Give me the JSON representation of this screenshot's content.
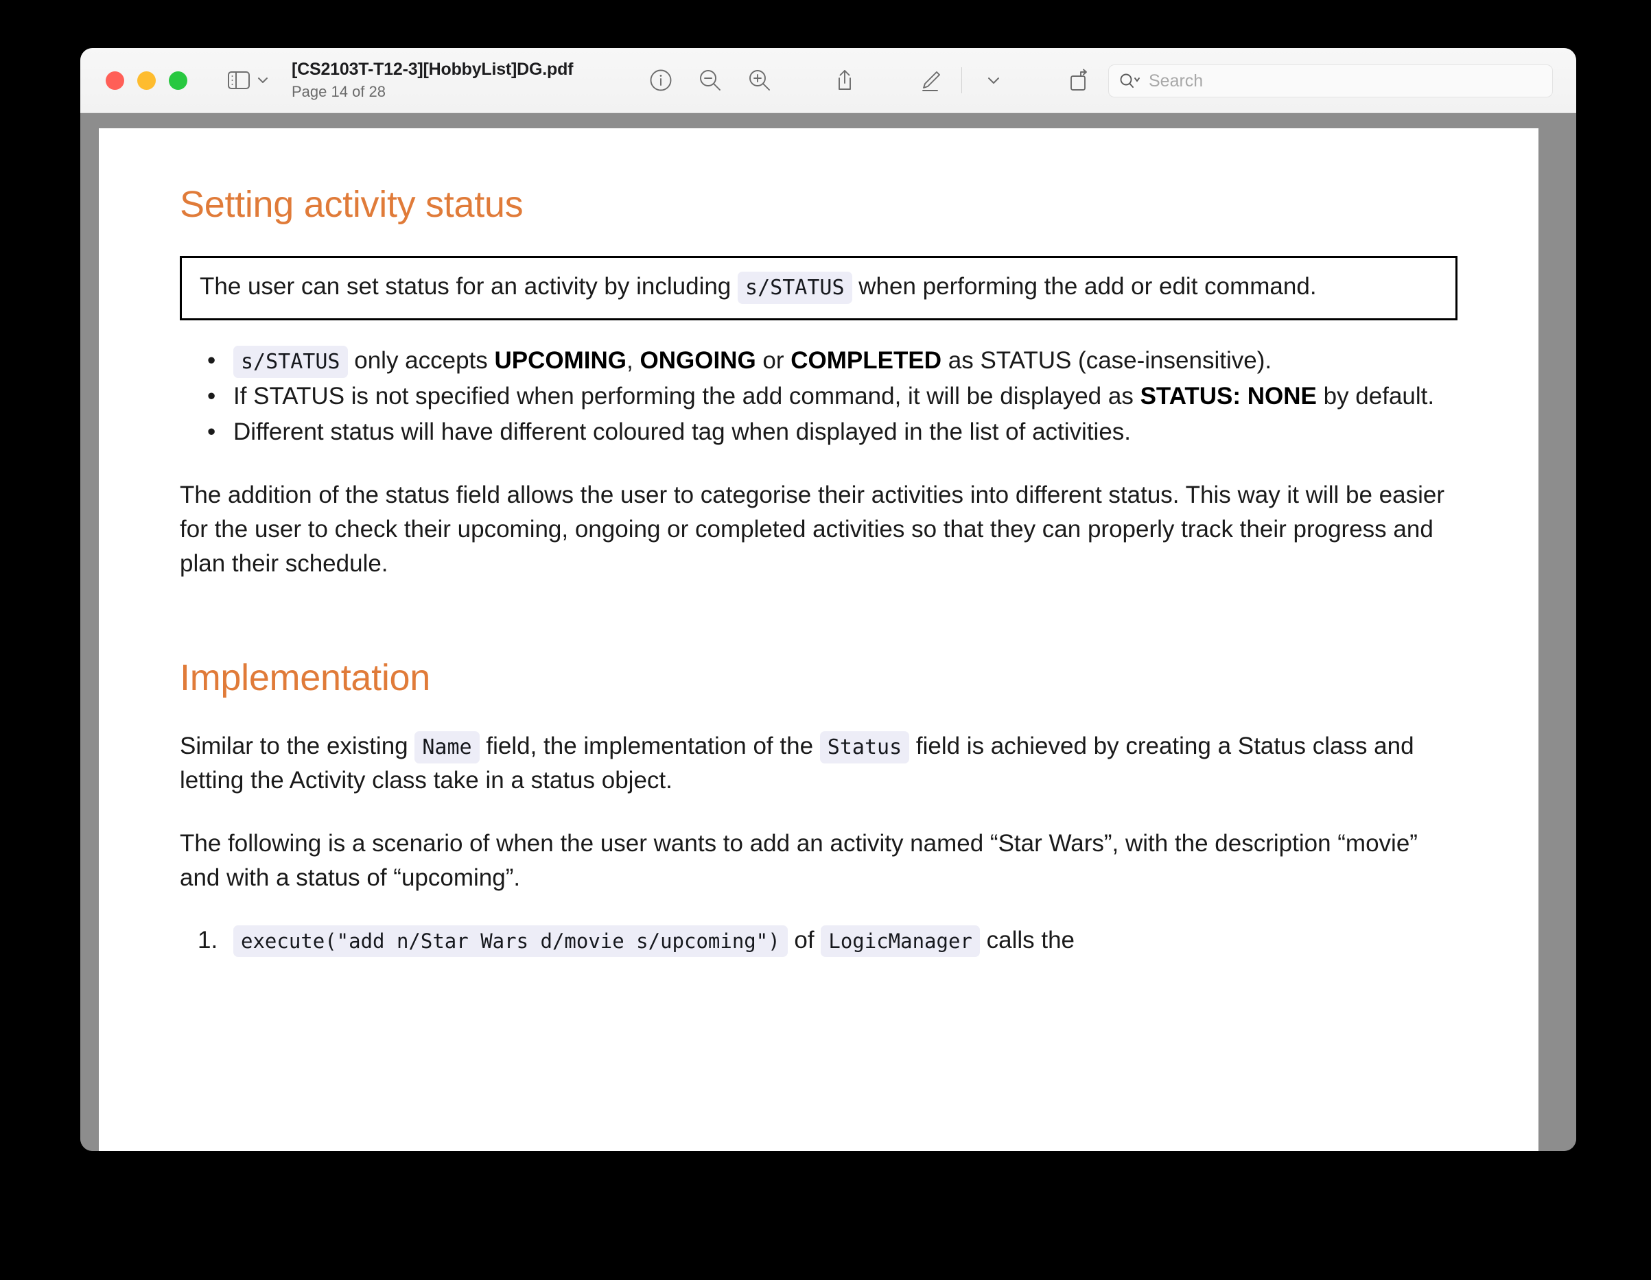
{
  "window": {
    "traffic_lights": [
      "close",
      "minimize",
      "maximize"
    ],
    "doc_title": "[CS2103T-T12-3][HobbyList]DG.pdf",
    "page_indicator": "Page 14 of 28",
    "toolbar": [
      {
        "name": "info-icon",
        "label": "Show Info"
      },
      {
        "name": "zoom-out-icon",
        "label": "Zoom Out"
      },
      {
        "name": "zoom-in-icon",
        "label": "Zoom In"
      },
      {
        "name": "share-icon",
        "label": "Share"
      },
      {
        "name": "markup-pen-icon",
        "label": "Markup"
      },
      {
        "name": "chevron-down-icon",
        "label": "Markup Options"
      },
      {
        "name": "rotate-icon",
        "label": "Rotate"
      },
      {
        "name": "annotate-icon",
        "label": "Annotate"
      }
    ],
    "search": {
      "placeholder": "Search",
      "value": ""
    }
  },
  "document": {
    "heading_1": "Setting activity status",
    "callout": {
      "part1": "The user can set status for an activity by including",
      "code": "s/STATUS",
      "part2": "when performing the add or edit command."
    },
    "bullets": [
      {
        "code": "s/STATUS",
        "text_a": "only accepts",
        "bold_1": "UPCOMING",
        "sep_1": ",",
        "bold_2": "ONGOING",
        "sep_2": "or",
        "bold_3": "COMPLETED",
        "text_b": "as STATUS (case-insensitive)."
      },
      {
        "text_a": "If STATUS is not specified when performing the add command, it will be displayed as",
        "bold_1": "STATUS: NONE",
        "text_b": "by default."
      },
      {
        "text_a": "Different status will have different coloured tag when displayed in the list of activities."
      }
    ],
    "paragraph_1": "The addition of the status field allows the user to categorise their activities into different status. This way it will be easier for the user to check their upcoming, ongoing or completed activities so that they can properly track their progress and plan their schedule.",
    "heading_2": "Implementation",
    "paragraph_2": {
      "part1": "Similar to the existing",
      "code1": "Name",
      "part2": "field, the implementation of the",
      "code2": "Status",
      "part3": "field is achieved by creating a Status class and letting the Activity class take in a status object."
    },
    "paragraph_3": "The following is a scenario of when the user wants to add an activity named “Star Wars”, with the description “movie” and with a status of “upcoming”.",
    "step_partial": {
      "code1": "execute(\"add n/Star Wars d/movie s/upcoming\")",
      "text_a": "of",
      "code2": "LogicManager",
      "text_b": "calls the"
    }
  },
  "colors": {
    "heading": "#e07b39",
    "code_chip_bg": "#ededf7",
    "window_bg": "#8d8d8d",
    "page_bg": "#ffffff"
  }
}
